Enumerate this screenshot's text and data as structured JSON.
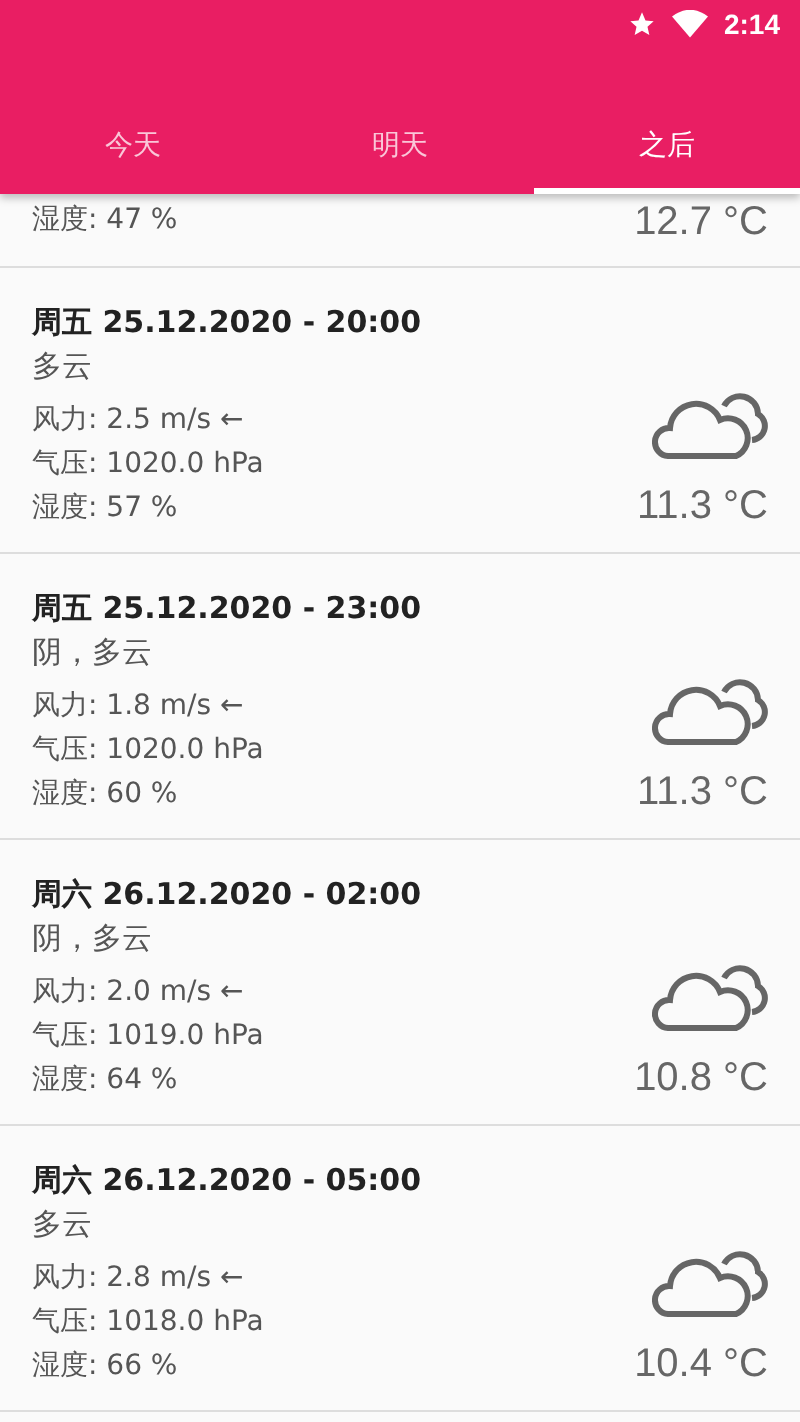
{
  "status_bar": {
    "time": "2:14"
  },
  "tabs": [
    {
      "label": "今天",
      "selected": false
    },
    {
      "label": "明天",
      "selected": false
    },
    {
      "label": "之后",
      "selected": true
    }
  ],
  "forecasts": [
    {
      "kind": "partial",
      "humidity": "湿度: 47 %",
      "temperature": "12.7 °C"
    },
    {
      "date": "周五 25.12.2020 - 20:00",
      "description": "多云",
      "kind": "entry",
      "wind": "风力: 2.5 m/s ←",
      "pressure": "气压: 1020.0 hPa",
      "humidity": "湿度: 57 %",
      "temperature": "11.3 °C"
    },
    {
      "date": "周五 25.12.2020 - 23:00",
      "description": "阴，多云",
      "kind": "entry",
      "wind": "风力: 1.8 m/s ←",
      "pressure": "气压: 1020.0 hPa",
      "humidity": "湿度: 60 %",
      "temperature": "11.3 °C"
    },
    {
      "date": "周六 26.12.2020 - 02:00",
      "description": "阴，多云",
      "kind": "entry",
      "wind": "风力: 2.0 m/s ←",
      "pressure": "气压: 1019.0 hPa",
      "humidity": "湿度: 64 %",
      "temperature": "10.8 °C"
    },
    {
      "date": "周六 26.12.2020 - 05:00",
      "description": "多云",
      "kind": "entry",
      "wind": "风力: 2.8 m/s ←",
      "pressure": "气压: 1018.0 hPa",
      "humidity": "湿度: 66 %",
      "temperature": "10.4 °C"
    }
  ]
}
